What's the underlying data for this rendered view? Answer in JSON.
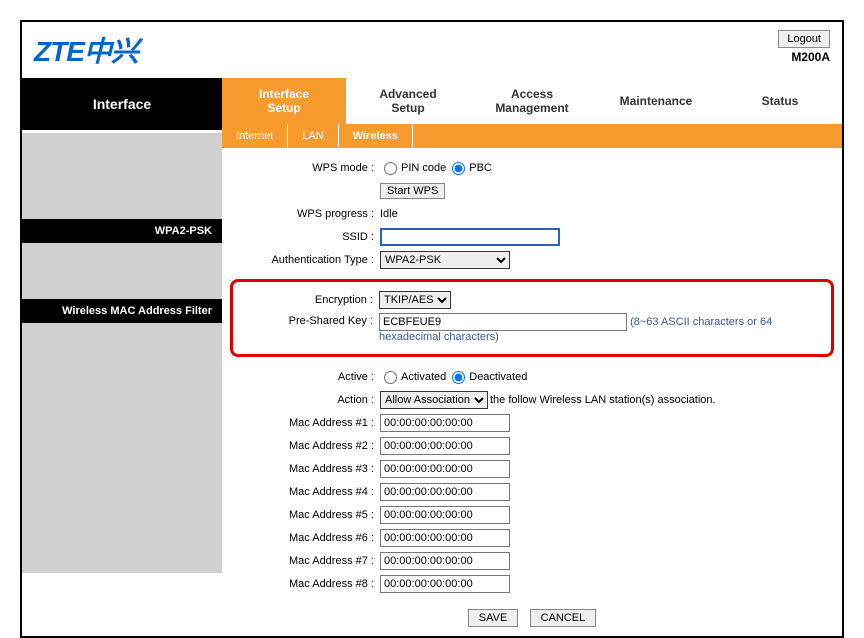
{
  "header": {
    "logo": "ZTE中兴",
    "logout": "Logout",
    "model": "M200A"
  },
  "side": {
    "title": "Interface",
    "wpa": "WPA2-PSK",
    "macfilter": "Wireless MAC Address Filter"
  },
  "tabs": {
    "interface": "Interface\nSetup",
    "advanced": "Advanced\nSetup",
    "access": "Access\nManagement",
    "maintenance": "Maintenance",
    "status": "Status"
  },
  "subtabs": {
    "internet": "Internet",
    "lan": "LAN",
    "wireless": "Wireless"
  },
  "labels": {
    "wpsmode": "WPS mode :",
    "pin": "PIN code",
    "pbc": "PBC",
    "startwps": "Start WPS",
    "wpsprogress": "WPS progress :",
    "idle": "Idle",
    "ssid": "SSID :",
    "authtype": "Authentication Type :",
    "wpa2psk": "WPA2-PSK",
    "encryption": "Encryption :",
    "tkipaes": "TKIP/AES",
    "psk": "Pre-Shared Key :",
    "pskval": "ECBFEUE9",
    "pskhint1": "(8~63 ASCII characters or 64",
    "pskhint2": "hexadecimal characters)",
    "active": "Active :",
    "activated": "Activated",
    "deactivated": "Deactivated",
    "action": "Action :",
    "allow": "Allow Association",
    "actionhint": "the follow Wireless LAN station(s) association.",
    "mac1": "Mac Address #1 :",
    "mac2": "Mac Address #2 :",
    "mac3": "Mac Address #3 :",
    "mac4": "Mac Address #4 :",
    "mac5": "Mac Address #5 :",
    "mac6": "Mac Address #6 :",
    "mac7": "Mac Address #7 :",
    "mac8": "Mac Address #8 :",
    "macval": "00:00:00:00:00:00",
    "save": "SAVE",
    "cancel": "CANCEL"
  }
}
